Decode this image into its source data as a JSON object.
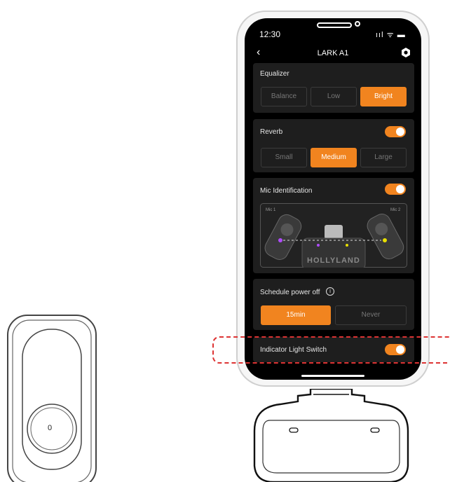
{
  "status_bar": {
    "time": "12:30",
    "icons": "ııl ᯤ ▬"
  },
  "header": {
    "back": "‹",
    "title": "LARK A1"
  },
  "equalizer": {
    "title": "Equalizer",
    "options": [
      "Balance",
      "Low",
      "Bright"
    ],
    "selected": "Bright"
  },
  "reverb": {
    "title": "Reverb",
    "enabled": true,
    "options": [
      "Small",
      "Medium",
      "Large"
    ],
    "selected": "Medium"
  },
  "mic_identification": {
    "title": "Mic Identification",
    "enabled": true,
    "mic1": "Mic 1",
    "mic2": "Mic 2",
    "brand": "HOLLYLAND"
  },
  "schedule_power_off": {
    "title": "Schedule power off",
    "info": "i",
    "options": [
      "15min",
      "Never"
    ],
    "selected": "15min"
  },
  "indicator_light": {
    "title": "Indicator Light Switch",
    "enabled": true
  },
  "transmitter": {
    "indicator": "0"
  },
  "colors": {
    "accent": "#f1841f",
    "card": "#1e1e1e",
    "highlight_dash": "#dd3333"
  }
}
